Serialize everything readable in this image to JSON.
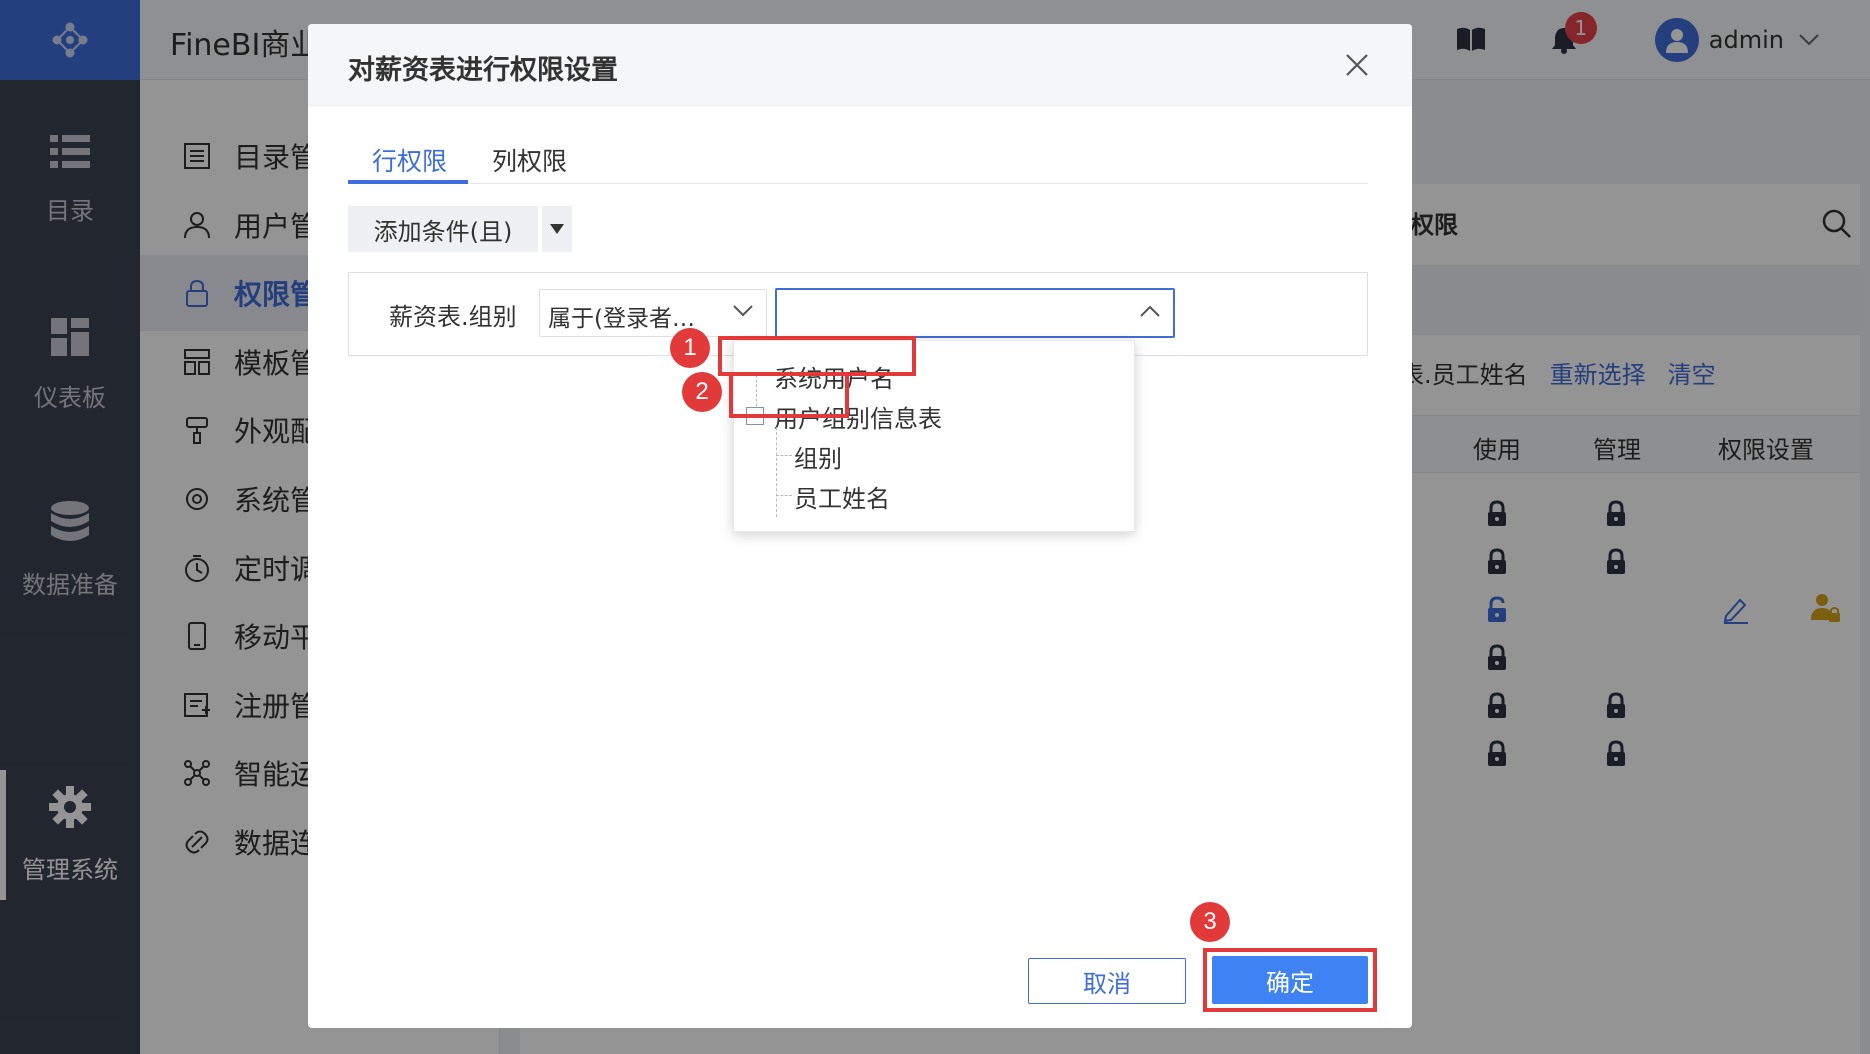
{
  "app": {
    "title": "FineBI商业"
  },
  "topbar": {
    "notification_count": "1",
    "user_name": "admin"
  },
  "rail": {
    "items": [
      {
        "label": "目录",
        "icon": "list-icon"
      },
      {
        "label": "仪表板",
        "icon": "dashboard-icon"
      },
      {
        "label": "数据准备",
        "icon": "database-icon"
      },
      {
        "label": "管理系统",
        "icon": "gear-icon"
      }
    ]
  },
  "menu": {
    "items": [
      {
        "label": "目录管",
        "icon": "catalog-icon"
      },
      {
        "label": "用户管",
        "icon": "user-icon"
      },
      {
        "label": "权限管",
        "icon": "lock-icon"
      },
      {
        "label": "模板管",
        "icon": "template-icon"
      },
      {
        "label": "外观配",
        "icon": "brush-icon"
      },
      {
        "label": "系统管",
        "icon": "settings-icon"
      },
      {
        "label": "定时调",
        "icon": "timer-icon"
      },
      {
        "label": "移动平",
        "icon": "mobile-icon"
      },
      {
        "label": "注册管",
        "icon": "register-icon"
      },
      {
        "label": "智能运",
        "icon": "network-icon"
      },
      {
        "label": "数据连",
        "icon": "link-icon"
      }
    ]
  },
  "background": {
    "header": "权限",
    "filter_text": "表.员工姓名",
    "reselect_link": "重新选择",
    "clear_link": "清空",
    "columns": [
      "使用",
      "管理",
      "权限设置"
    ]
  },
  "dialog": {
    "title": "对薪资表进行权限设置",
    "tabs": [
      "行权限",
      "列权限"
    ],
    "active_tab": 0,
    "add_condition_label": "添加条件(且)",
    "condition": {
      "field": "薪资表.组别",
      "operator": "属于(登录者…",
      "value": ""
    },
    "tree": {
      "nodes": [
        {
          "label": "系统用户名"
        },
        {
          "label": "用户组别信息表",
          "expanded": true
        },
        {
          "label": "组别"
        },
        {
          "label": "员工姓名"
        }
      ]
    },
    "steps": [
      "1",
      "2",
      "3"
    ],
    "cancel_label": "取消",
    "ok_label": "确定"
  },
  "colors": {
    "accent": "#3f6dd9",
    "primary_button": "#3f82f4",
    "rail_bg": "#3c4352",
    "annotation_red": "#e23a3a",
    "badge_red": "#e5434a"
  }
}
